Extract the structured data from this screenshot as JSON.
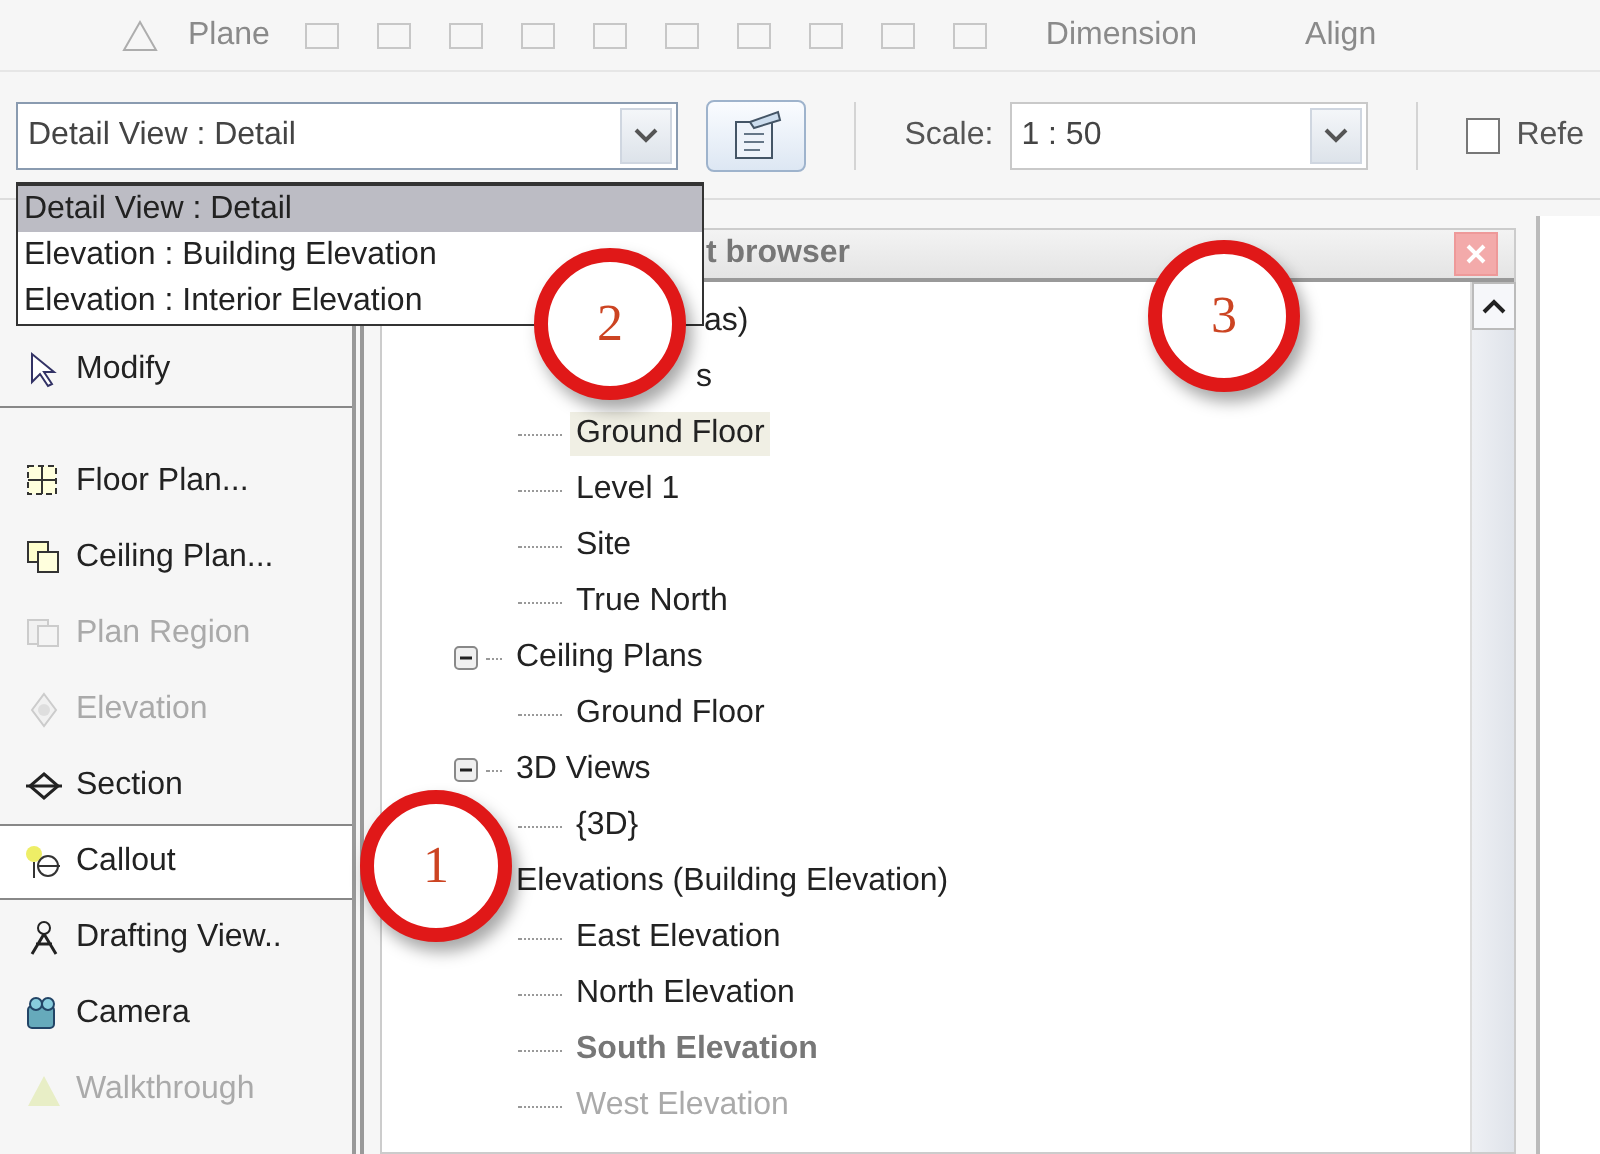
{
  "toolbar": {
    "items": [
      {
        "label": "Plane"
      },
      {
        "label": "Dimension"
      },
      {
        "label": "Align"
      }
    ]
  },
  "options_bar": {
    "type_selector": {
      "value": "Detail View : Detail",
      "expanded": true,
      "options": [
        {
          "label": "Detail View : Detail",
          "selected": true
        },
        {
          "label": "Elevation : Building Elevation",
          "selected": false
        },
        {
          "label": "Elevation : Interior Elevation",
          "selected": false
        }
      ]
    },
    "scale": {
      "label": "Scale:",
      "value": "1 : 50"
    },
    "checkbox": {
      "label": "Refe",
      "checked": false
    }
  },
  "tools": [
    {
      "label": "Modify",
      "disabled": false,
      "selected": false
    },
    {
      "label": "Floor Plan...",
      "disabled": false,
      "selected": false
    },
    {
      "label": "Ceiling Plan...",
      "disabled": false,
      "selected": false
    },
    {
      "label": "Plan Region",
      "disabled": true,
      "selected": false
    },
    {
      "label": "Elevation",
      "disabled": true,
      "selected": false
    },
    {
      "label": "Section",
      "disabled": false,
      "selected": false
    },
    {
      "label": "Callout",
      "disabled": false,
      "selected": true
    },
    {
      "label": "Drafting View..",
      "disabled": false,
      "selected": false
    },
    {
      "label": "Camera",
      "disabled": false,
      "selected": false
    },
    {
      "label": "Walkthrough",
      "disabled": true,
      "selected": false
    }
  ],
  "project_browser": {
    "title": "t browser",
    "tree": [
      {
        "label": "as)",
        "children": [
          {
            "label": "s",
            "children": [
              {
                "label": "Ground Floor",
                "selected": true
              },
              {
                "label": "Level 1",
                "selected": false
              },
              {
                "label": "Site",
                "selected": false
              },
              {
                "label": "True North",
                "selected": false
              }
            ]
          },
          {
            "label": "Ceiling Plans",
            "expanded": true,
            "children": [
              {
                "label": "Ground Floor",
                "selected": false
              }
            ]
          },
          {
            "label": "3D Views",
            "expanded": true,
            "children": [
              {
                "label": "{3D}",
                "selected": false
              }
            ]
          },
          {
            "label": "Elevations (Building Elevation)",
            "children": [
              {
                "label": "East Elevation",
                "selected": false
              },
              {
                "label": "North Elevation",
                "selected": false
              },
              {
                "label": "South Elevation",
                "selected": false,
                "bold": true
              },
              {
                "label": "West Elevation",
                "selected": false,
                "faded": true
              }
            ]
          }
        ]
      }
    ]
  },
  "callouts": [
    {
      "number": "1"
    },
    {
      "number": "2"
    },
    {
      "number": "3"
    }
  ]
}
